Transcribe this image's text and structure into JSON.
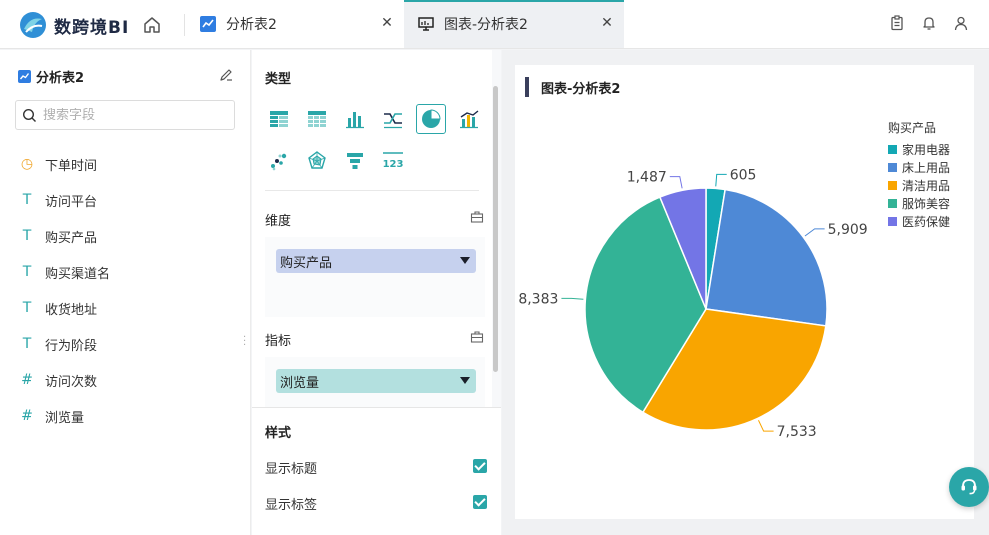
{
  "app": {
    "logo_text": "数跨境BI"
  },
  "tabs": [
    {
      "label": "分析表2",
      "icon": "line-chart-icon"
    },
    {
      "label": "图表-分析表2",
      "icon": "dashboard-icon",
      "active": true
    }
  ],
  "top_actions": [
    "clipboard-icon",
    "bell-icon",
    "user-icon"
  ],
  "left_panel": {
    "title": "分析表2",
    "search_placeholder": "搜索字段",
    "fields": [
      {
        "type_glyph": "◷",
        "type": "date",
        "name": "下单时间"
      },
      {
        "type_glyph": "T",
        "type": "text",
        "name": "访问平台"
      },
      {
        "type_glyph": "T",
        "type": "text",
        "name": "购买产品"
      },
      {
        "type_glyph": "T",
        "type": "text",
        "name": "购买渠道名"
      },
      {
        "type_glyph": "T",
        "type": "text",
        "name": "收货地址"
      },
      {
        "type_glyph": "T",
        "type": "text",
        "name": "行为阶段"
      },
      {
        "type_glyph": "#",
        "type": "number",
        "name": "访问次数"
      },
      {
        "type_glyph": "#",
        "type": "number",
        "name": "浏览量"
      }
    ]
  },
  "config_panel": {
    "type_label": "类型",
    "chart_types": [
      "table-icon",
      "cross-table-icon",
      "bar-chart-icon",
      "line-chart-icon",
      "pie-chart-icon",
      "combo-chart-icon",
      "scatter-chart-icon",
      "radar-chart-icon",
      "funnel-chart-icon",
      "number-card-icon"
    ],
    "active_chart_type": "pie-chart-icon",
    "dimension_label": "维度",
    "dimension_value": "购买产品",
    "measure_label": "指标",
    "measure_value": "浏览量",
    "style_label": "样式",
    "options": [
      {
        "label": "显示标题",
        "checked": true
      },
      {
        "label": "显示标签",
        "checked": true
      }
    ]
  },
  "chart_card": {
    "title": "图表-分析表2"
  },
  "colors": {
    "accent": "#2aa6a8",
    "dimension_pill": "#c6d1ee",
    "measure_pill": "#b3e0df"
  },
  "chart_data": {
    "type": "pie",
    "title": "图表-分析表2",
    "legend_title": "购买产品",
    "legend_position": "top-right",
    "slices": [
      {
        "label": "家用电器",
        "value": 605,
        "display": "605",
        "color": "#13a8b4"
      },
      {
        "label": "床上用品",
        "value": 5909,
        "display": "5,909",
        "color": "#4e89d6"
      },
      {
        "label": "清洁用品",
        "value": 7533,
        "display": "7,533",
        "color": "#f9a500"
      },
      {
        "label": "服饰美容",
        "value": 8383,
        "display": "8,383",
        "color": "#33b396"
      },
      {
        "label": "医药保健",
        "value": 1487,
        "display": "1,487",
        "color": "#7375e6"
      }
    ]
  }
}
